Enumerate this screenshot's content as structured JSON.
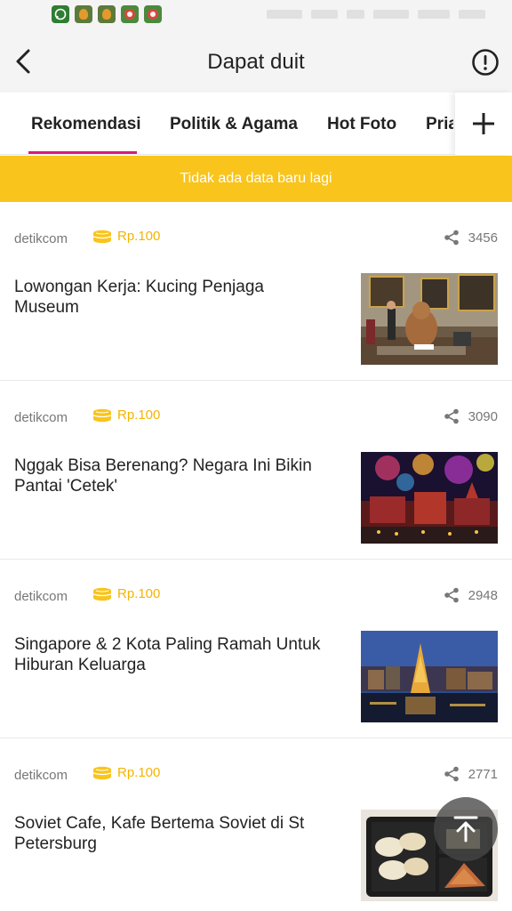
{
  "status_bar": {
    "app_icons": [
      {
        "name": "whatsapp-icon",
        "color": "#3a8a3a"
      },
      {
        "name": "location-app-icon",
        "color": "#b06a1c"
      },
      {
        "name": "location-app-icon",
        "color": "#b06a1c"
      },
      {
        "name": "browser-app-icon",
        "color": "#3a8a3a"
      },
      {
        "name": "browser-app-icon",
        "color": "#3a8a3a"
      }
    ]
  },
  "header": {
    "title": "Dapat duit",
    "back_icon": "chevron-left-icon",
    "info_icon": "info-circle-icon"
  },
  "tabs": {
    "items": [
      {
        "label": "Rekomendasi",
        "active": true
      },
      {
        "label": "Politik & Agama",
        "active": false
      },
      {
        "label": "Hot Foto",
        "active": false
      },
      {
        "label": "Pria",
        "active": false
      }
    ],
    "add_icon": "plus-icon",
    "accent_color": "#d81b7a"
  },
  "banner": {
    "text": "Tidak ada data baru lagi",
    "color": "#f9c41c"
  },
  "feed": {
    "items": [
      {
        "source": "detikcom",
        "reward": "Rp.100",
        "shares": "3456",
        "title": "Lowongan Kerja: Kucing Penjaga Museum",
        "thumb": "museum-cat-photo"
      },
      {
        "source": "detikcom",
        "reward": "Rp.100",
        "shares": "3090",
        "title": "Nggak Bisa Berenang? Negara Ini Bikin Pantai 'Cetek'",
        "thumb": "fireworks-city-photo"
      },
      {
        "source": "detikcom",
        "reward": "Rp.100",
        "shares": "2948",
        "title": "Singapore & 2 Kota Paling Ramah Untuk Hiburan Keluarga",
        "thumb": "christmas-tree-harbor-photo"
      },
      {
        "source": "detikcom",
        "reward": "Rp.100",
        "shares": "2771",
        "title": "Soviet Cafe, Kafe Bertema Soviet di St Petersburg",
        "thumb": "food-tray-photo"
      }
    ],
    "reward_color": "#f4b400",
    "coin_icon": "coin-stack-icon",
    "share_icon": "share-icon"
  },
  "scroll_top": {
    "icon": "arrow-up-to-top-icon"
  }
}
